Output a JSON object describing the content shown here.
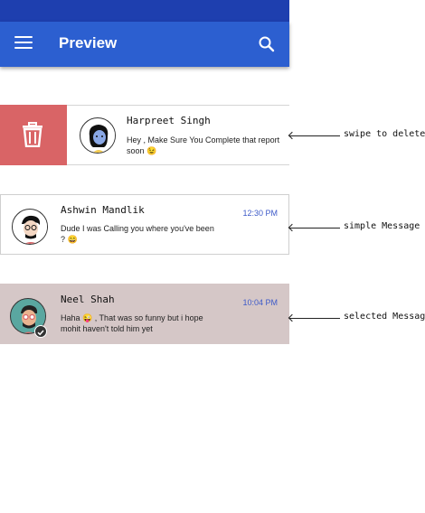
{
  "app_bar": {
    "title": "Preview",
    "menu_icon": "menu-icon",
    "search_icon": "search-icon",
    "status_color": "#1e3faf",
    "bar_color": "#2c5fd0"
  },
  "swipe_row": {
    "delete_icon": "trash-icon",
    "delete_color": "#d96466",
    "name": "Harpreet Singh",
    "message": "Hey , Make Sure You Complete that report soon 😉"
  },
  "simple_row": {
    "name": "Ashwin Mandlik",
    "message": "Dude  I was Calling you where you've been ? 😄",
    "time": "12:30 PM"
  },
  "selected_row": {
    "name": "Neel Shah",
    "message": "Haha 😜 , That was so funny but i hope mohit haven't told him yet",
    "time": "10:04 PM",
    "selected_color": "#d5c7c7",
    "badge_icon": "check-icon"
  },
  "annotations": {
    "swipe": "swipe to delete",
    "simple": "simple Message",
    "selected": "selected Message"
  }
}
